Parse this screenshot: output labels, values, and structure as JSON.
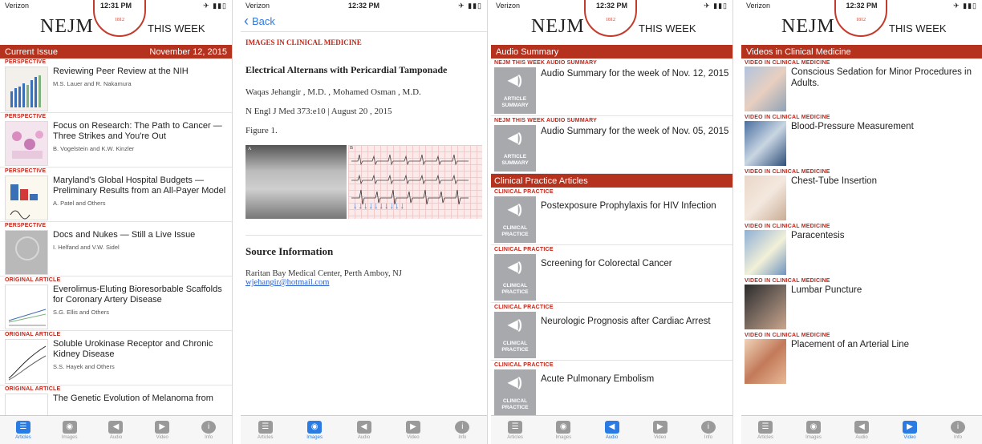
{
  "status": {
    "carrier": "Verizon",
    "times": [
      "12:31 PM",
      "12:32 PM",
      "12:32 PM",
      "12:32 PM"
    ]
  },
  "brand": {
    "logo": "NEJM",
    "tagline": "THIS WEEK"
  },
  "screen1": {
    "header_left": "Current Issue",
    "header_right": "November 12, 2015",
    "articles": [
      {
        "type": "PERSPECTIVE",
        "title": "Reviewing Peer Review at the NIH",
        "authors": "M.S. Lauer and R. Nakamura"
      },
      {
        "type": "PERSPECTIVE",
        "title": "Focus on Research: The Path to Cancer — Three Strikes and You're Out",
        "authors": "B. Vogelstein and K.W. Kinzler"
      },
      {
        "type": "PERSPECTIVE",
        "title": "Maryland's Global Hospital Budgets — Preliminary Results from an All-Payer Model",
        "authors": "A. Patel and Others"
      },
      {
        "type": "PERSPECTIVE",
        "title": "Docs and Nukes — Still a Live Issue",
        "authors": "I. Helfand and V.W. Sidel"
      },
      {
        "type": "ORIGINAL ARTICLE",
        "title": "Everolimus-Eluting Bioresorbable Scaffolds for Coronary Artery Disease",
        "authors": "S.G. Ellis and Others"
      },
      {
        "type": "ORIGINAL ARTICLE",
        "title": "Soluble Urokinase Receptor and Chronic Kidney Disease",
        "authors": "S.S. Hayek and Others"
      },
      {
        "type": "ORIGINAL ARTICLE",
        "title": "The Genetic Evolution of Melanoma from",
        "authors": ""
      }
    ]
  },
  "screen2": {
    "back": "Back",
    "section": "IMAGES IN CLINICAL MEDICINE",
    "headline": "Electrical Alternans with Pericardial Tamponade",
    "authors": "Waqas Jehangir , M.D. , Mohamed Osman , M.D.",
    "citation": "N Engl J Med 373:e10 | August 20 , 2015",
    "figure": "Figure 1.",
    "panel_a": "A",
    "panel_b": "B",
    "source_heading": "Source Information",
    "institution": "Raritan Bay Medical Center, Perth Amboy, NJ",
    "email": "wjehangir@hotmail.com"
  },
  "screen3": {
    "audio_header": "Audio Summary",
    "audio_kicker": "NEJM THIS WEEK AUDIO SUMMARY",
    "audio_badge": "ARTICLE SUMMARY",
    "audio_items": [
      "Audio Summary for the week of Nov. 12, 2015",
      "Audio Summary for the week of Nov. 05, 2015"
    ],
    "cp_header": "Clinical Practice Articles",
    "cp_kicker": "CLINICAL PRACTICE",
    "cp_badge": "CLINICAL PRACTICE",
    "cp_items": [
      "Postexposure Prophylaxis for HIV Infection",
      "Screening for Colorectal Cancer",
      "Neurologic Prognosis after Cardiac Arrest",
      "Acute Pulmonary Embolism"
    ]
  },
  "screen4": {
    "header": "Videos in Clinical Medicine",
    "kicker": "VIDEO IN CLINICAL MEDICINE",
    "videos": [
      "Conscious Sedation for Minor Procedures in Adults.",
      "Blood-Pressure Measurement",
      "Chest-Tube Insertion",
      "Paracentesis",
      "Lumbar Puncture",
      "Placement of an Arterial Line"
    ]
  },
  "tabs": [
    "Articles",
    "Images",
    "Audio",
    "Video",
    "Info"
  ],
  "colors": {
    "brand_red": "#b5321f",
    "kicker_red": "#c4261a",
    "ios_blue": "#2a7be4",
    "badge_gray": "#a7a9ad"
  }
}
